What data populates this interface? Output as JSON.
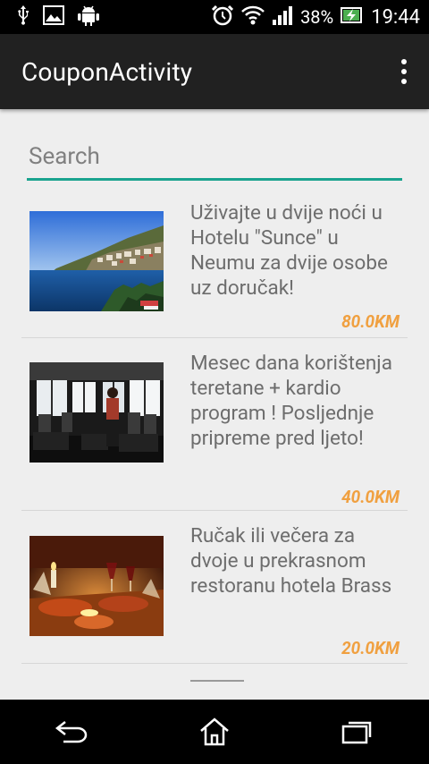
{
  "status_bar": {
    "icons": [
      "usb-icon",
      "image-icon",
      "android-icon",
      "alarm-icon",
      "wifi-icon",
      "signal-icon",
      "battery-charging-icon"
    ],
    "battery": "38%",
    "time": "19:44"
  },
  "action_bar": {
    "title": "CouponActivity",
    "overflow_icon": "more-vert-icon"
  },
  "search": {
    "placeholder": "Search",
    "value": "",
    "accent": "#1aa38f"
  },
  "coupons": [
    {
      "title": "Uživajte u dvije noći u Hotelu \"Sunce\" u Neumu za dvije osobe uz doručak!",
      "price": "80.0KM",
      "image": "coastal-town-photo"
    },
    {
      "title": "Mesec dana korištenja teretane + kardio program ! Posljednje pripreme pred ljeto!",
      "price": "40.0KM",
      "image": "gym-photo"
    },
    {
      "title": "Ručak ili večera za dvoje u prekrasnom restoranu hotela Brass",
      "price": "20.0KM",
      "image": "candlelight-dinner-photo"
    }
  ],
  "colors": {
    "price": "#f0a040",
    "title_text": "#6d6d6d",
    "action_bar": "#212121"
  },
  "nav_bar": {
    "icons": [
      "back-icon",
      "home-icon",
      "recent-apps-icon"
    ]
  }
}
